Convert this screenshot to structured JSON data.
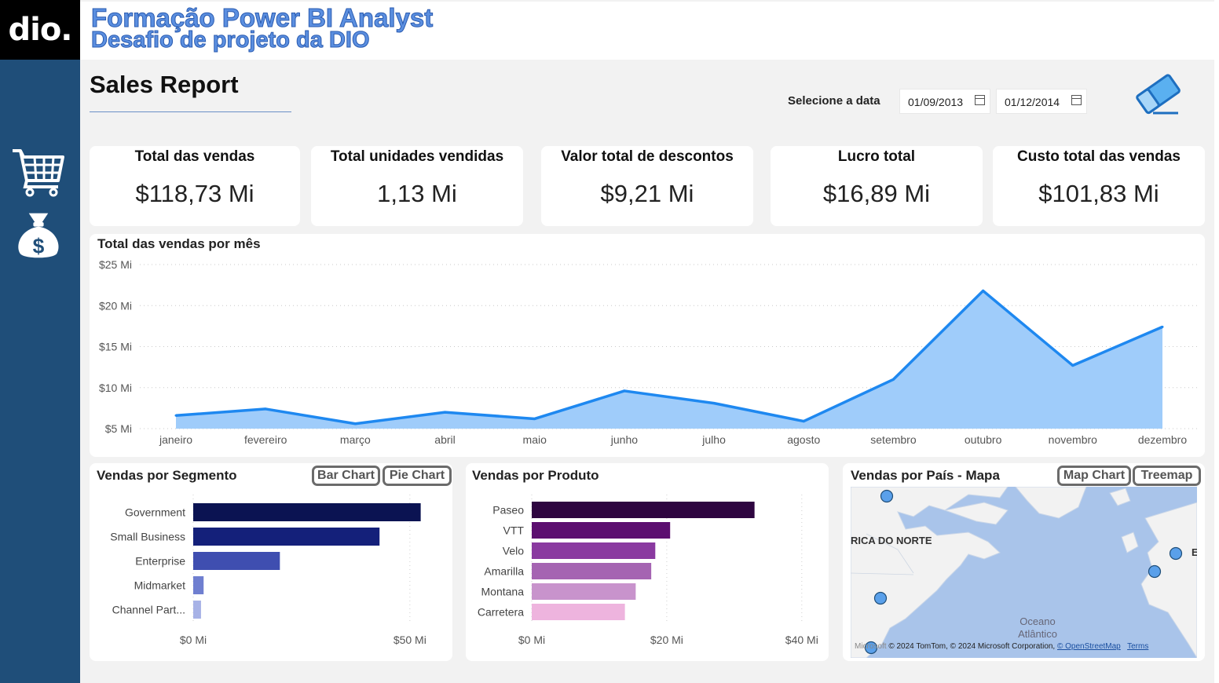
{
  "logo": "dio.",
  "header": {
    "title": "Formação Power BI Analyst",
    "subtitle": "Desafio de projeto da DIO"
  },
  "sidebar": {
    "icons": [
      "shopping-cart-icon",
      "money-bag-icon"
    ]
  },
  "page_title": "Sales Report",
  "date_filter": {
    "label": "Selecione a data",
    "start": "01/09/2013",
    "end": "01/12/2014"
  },
  "kpis": [
    {
      "title": "Total das vendas",
      "value": "$118,73 Mi"
    },
    {
      "title": "Total unidades vendidas",
      "value": "1,13 Mi"
    },
    {
      "title": "Valor total de descontos",
      "value": "$9,21 Mi"
    },
    {
      "title": "Lucro total",
      "value": "$16,89 Mi"
    },
    {
      "title": "Custo total das vendas",
      "value": "$101,83 Mi"
    }
  ],
  "segment_toggles": {
    "bar": "Bar Chart",
    "pie": "Pie Chart"
  },
  "map_toggles": {
    "map": "Map Chart",
    "treemap": "Treemap"
  },
  "map": {
    "title": "Vendas por País - Mapa",
    "labels": {
      "north_america": "RICA DO NORTE",
      "ocean_line1": "Oceano",
      "ocean_line2": "Atlântico",
      "edge": "E"
    },
    "attribution": {
      "brand": "Microsoft",
      "text": "© 2024 TomTom, © 2024 Microsoft Corporation, ",
      "osm": "© OpenStreetMap",
      "terms": "Terms"
    },
    "water_color": "#a9c4ea",
    "land_color": "#f2f2f2",
    "marker_color": "#5aa0ea"
  },
  "colors": {
    "sidebar": "#1f4e79",
    "area_fill": "#9fccfa",
    "area_line": "#1e88f0"
  },
  "chart_data": [
    {
      "type": "area",
      "title": "Total das vendas por mês",
      "categories": [
        "janeiro",
        "fevereiro",
        "março",
        "abril",
        "maio",
        "junho",
        "julho",
        "agosto",
        "setembro",
        "outubro",
        "novembro",
        "dezembro"
      ],
      "values": [
        6.6,
        7.4,
        5.6,
        7.0,
        6.2,
        9.6,
        8.1,
        5.9,
        11.0,
        21.8,
        12.7,
        17.4
      ],
      "y_ticks": [
        "$5 Mi",
        "$10 Mi",
        "$15 Mi",
        "$20 Mi",
        "$25 Mi"
      ],
      "ylim": [
        5,
        25
      ],
      "grid": true
    },
    {
      "type": "bar",
      "title": "Vendas por Segmento",
      "categories": [
        "Government",
        "Small Business",
        "Enterprise",
        "Midmarket",
        "Channel Part..."
      ],
      "values": [
        52.5,
        43.0,
        20.0,
        2.4,
        1.8
      ],
      "colors": [
        "#0b1352",
        "#14207a",
        "#3f4eb0",
        "#6f7fd0",
        "#a7b2e6"
      ],
      "x_ticks": [
        "$0 Mi",
        "$50 Mi"
      ],
      "xlim": [
        0,
        60
      ]
    },
    {
      "type": "bar",
      "title": "Vendas por Produto",
      "categories": [
        "Paseo",
        "VTT",
        "Velo",
        "Amarilla",
        "Montana",
        "Carretera"
      ],
      "values": [
        33.0,
        20.5,
        18.3,
        17.7,
        15.4,
        13.8
      ],
      "colors": [
        "#2e0540",
        "#5c0f70",
        "#8a3aa0",
        "#a564b2",
        "#c893cc",
        "#eeb4de"
      ],
      "x_ticks": [
        "$0 Mi",
        "$20 Mi",
        "$40 Mi"
      ],
      "xlim": [
        0,
        42
      ]
    }
  ]
}
